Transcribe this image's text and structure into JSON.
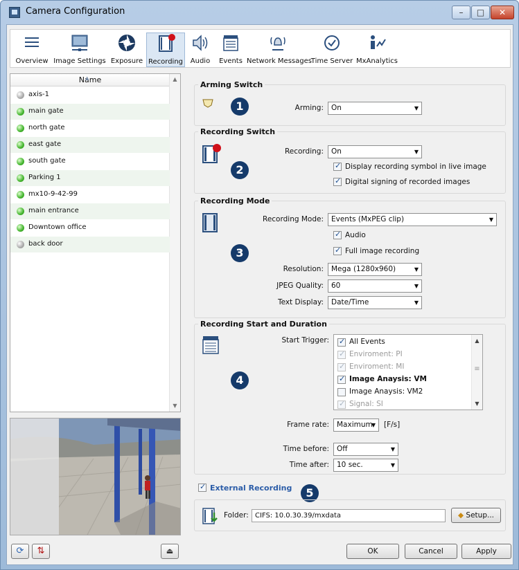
{
  "window": {
    "title": "Camera Configuration",
    "minimize": "–",
    "maximize": "□",
    "close": "✕"
  },
  "toolbar": [
    {
      "label": "Overview",
      "icon": "overview-icon"
    },
    {
      "label": "Image Settings",
      "icon": "image-settings-icon"
    },
    {
      "label": "Exposure",
      "icon": "exposure-icon"
    },
    {
      "label": "Recording",
      "icon": "recording-icon",
      "active": true
    },
    {
      "label": "Audio",
      "icon": "audio-icon"
    },
    {
      "label": "Events",
      "icon": "events-icon"
    },
    {
      "label": "Network Messages",
      "icon": "network-messages-icon"
    },
    {
      "label": "Time Server",
      "icon": "time-server-icon"
    },
    {
      "label": "MxAnalytics",
      "icon": "mxanalytics-icon"
    }
  ],
  "camera_list": {
    "header": "Name",
    "items": [
      {
        "name": "axis-1",
        "status": "grey"
      },
      {
        "name": "main gate",
        "status": "green"
      },
      {
        "name": "north gate",
        "status": "green"
      },
      {
        "name": "east gate",
        "status": "green"
      },
      {
        "name": "south gate",
        "status": "green"
      },
      {
        "name": "Parking 1",
        "status": "green"
      },
      {
        "name": "mx10-9-42-99",
        "status": "green"
      },
      {
        "name": "main entrance",
        "status": "green"
      },
      {
        "name": "Downtown office",
        "status": "green"
      },
      {
        "name": "back door",
        "status": "grey"
      }
    ]
  },
  "arming": {
    "title": "Arming Switch",
    "label": "Arming:",
    "value": "On",
    "badge": "1"
  },
  "recording_switch": {
    "title": "Recording Switch",
    "label": "Recording:",
    "value": "On",
    "badge": "2",
    "opt1": "Display recording symbol in live image",
    "opt2": "Digital signing of recorded images"
  },
  "recording_mode": {
    "title": "Recording Mode",
    "badge": "3",
    "mode_label": "Recording Mode:",
    "mode_value": "Events (MxPEG clip)",
    "audio": "Audio",
    "full_image": "Full image recording",
    "resolution_label": "Resolution:",
    "resolution_value": "Mega (1280x960)",
    "jpeg_label": "JPEG Quality:",
    "jpeg_value": "60",
    "text_label": "Text Display:",
    "text_value": "Date/Time"
  },
  "start_duration": {
    "title": "Recording Start and Duration",
    "badge": "4",
    "trigger_label": "Start Trigger:",
    "triggers": [
      {
        "label": "All Events",
        "checked": true,
        "dim": false,
        "bold": false
      },
      {
        "label": "Enviroment: PI",
        "checked": true,
        "dim": true,
        "bold": false
      },
      {
        "label": "Enviroment: MI",
        "checked": true,
        "dim": true,
        "bold": false
      },
      {
        "label": "Image Anaysis: VM",
        "checked": true,
        "dim": false,
        "bold": true
      },
      {
        "label": "Image Anaysis: VM2",
        "checked": false,
        "dim": false,
        "bold": false
      },
      {
        "label": "Signal: SI",
        "checked": true,
        "dim": true,
        "bold": false
      }
    ],
    "framerate_label": "Frame rate:",
    "framerate_value": "Maximum",
    "framerate_unit": "[F/s]",
    "before_label": "Time before:",
    "before_value": "Off",
    "after_label": "Time after:",
    "after_value": "10 sec."
  },
  "external": {
    "label": "External Recording",
    "badge": "5",
    "folder_label": "Folder:",
    "folder_value": "CIFS: 10.0.30.39/mxdata",
    "setup": "Setup..."
  },
  "buttons": {
    "ok": "OK",
    "cancel": "Cancel",
    "apply": "Apply"
  }
}
